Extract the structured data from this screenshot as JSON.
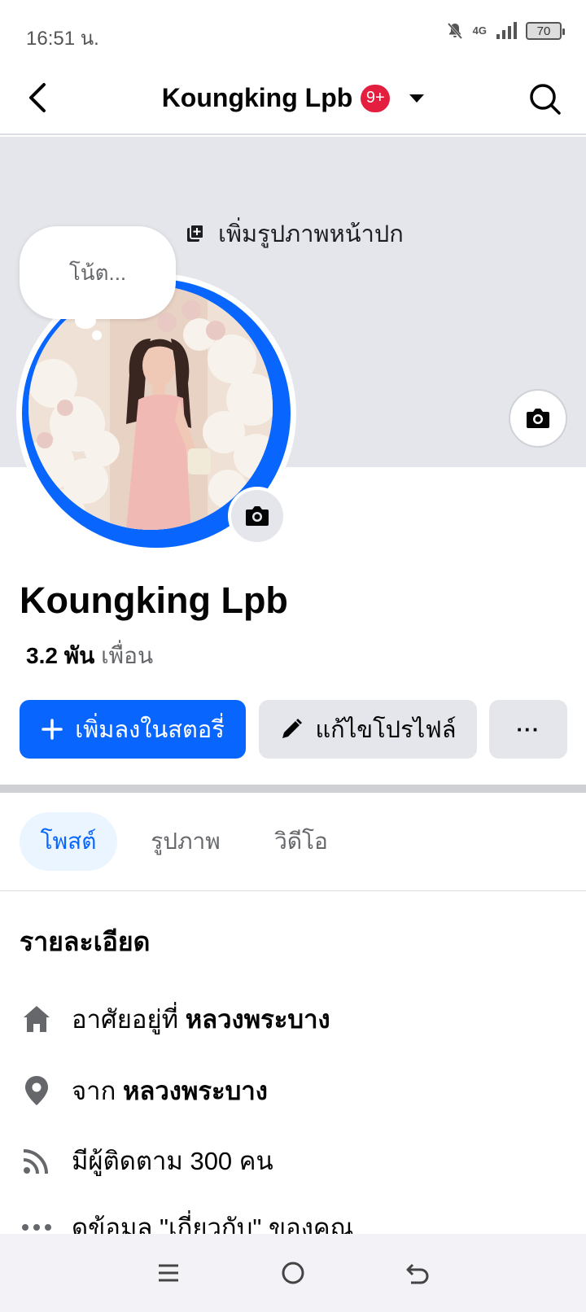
{
  "status_bar": {
    "time": "16:51 น.",
    "network": "4G",
    "battery": "70"
  },
  "header": {
    "title": "Koungking Lpb",
    "badge": "9+"
  },
  "cover": {
    "add_cover_label": "เพิ่มรูปภาพหน้าปก"
  },
  "note": {
    "placeholder": "โน้ต..."
  },
  "profile": {
    "name": "Koungking Lpb",
    "friends_count": "3.2 พัน",
    "friends_label": "เพื่อน"
  },
  "actions": {
    "add_story": "เพิ่มลงในสตอรี่",
    "edit_profile": "แก้ไขโปรไฟล์",
    "more": "···"
  },
  "tabs": [
    {
      "label": "โพสต์",
      "active": true
    },
    {
      "label": "รูปภาพ",
      "active": false
    },
    {
      "label": "วิดีโอ",
      "active": false
    }
  ],
  "details": {
    "title": "รายละเอียด",
    "items": [
      {
        "icon": "home-icon",
        "prefix": "อาศัยอยู่ที่",
        "value": "หลวงพระบาง"
      },
      {
        "icon": "location-pin-icon",
        "prefix": "จาก",
        "value": "หลวงพระบาง"
      },
      {
        "icon": "rss-icon",
        "prefix": "มีผู้ติดตาม 300 คน",
        "value": ""
      },
      {
        "icon": "more-dots-icon",
        "prefix": "ดูข้อมูล \"เกี่ยวกับ\" ของคุณ",
        "value": ""
      }
    ]
  },
  "colors": {
    "accent": "#0866ff",
    "badge": "#e41e3f",
    "cover_bg": "#e4e6eb"
  }
}
